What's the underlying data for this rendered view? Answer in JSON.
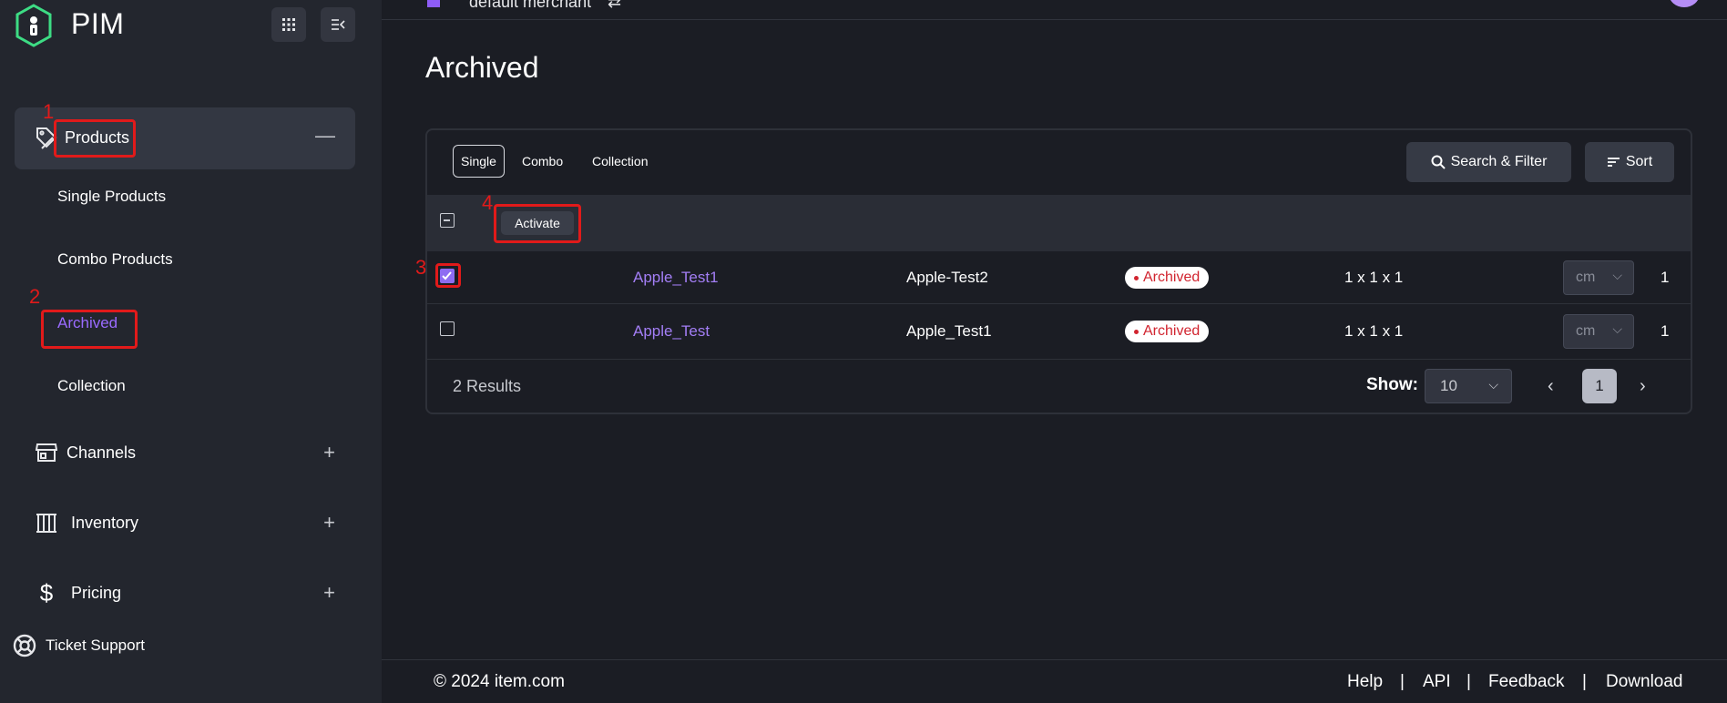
{
  "sidebar": {
    "brand": "PIM",
    "nav": [
      {
        "label": "Products",
        "toggle": "—"
      },
      {
        "label": "Channels",
        "toggle": "+"
      },
      {
        "label": "Inventory",
        "toggle": "+"
      },
      {
        "label": "Pricing",
        "toggle": "+"
      }
    ],
    "products_sub": [
      "Single Products",
      "Combo Products",
      "Archived",
      "Collection"
    ],
    "ticket_support": "Ticket Support"
  },
  "topbar": {
    "merchant": "default merchant"
  },
  "annotations": [
    "1",
    "2",
    "3",
    "4"
  ],
  "page": {
    "title": "Archived",
    "tabs": [
      "Single",
      "Combo",
      "Collection"
    ],
    "search_filter": "Search & Filter",
    "sort": "Sort",
    "bulk_action": "Activate"
  },
  "table": {
    "rows": [
      {
        "checked": true,
        "name": "Apple_Test1",
        "name2": "Apple-Test2",
        "status": "Archived",
        "dims": "1 x 1 x 1",
        "unit": "cm",
        "qty": "1"
      },
      {
        "checked": false,
        "name": "Apple_Test",
        "name2": "Apple_Test1",
        "status": "Archived",
        "dims": "1 x 1 x 1",
        "unit": "cm",
        "qty": "1"
      }
    ]
  },
  "pagination": {
    "results": "2 Results",
    "show_label": "Show:",
    "page_size": "10",
    "current_page": "1"
  },
  "footer": {
    "copyright": "© 2024 item.com",
    "links": [
      "Help",
      "API",
      "Feedback",
      "Download"
    ],
    "separator": "|"
  },
  "colors": {
    "accent": "#9a6bff",
    "annotation": "#e11a1a",
    "badge_text": "#d1242f"
  }
}
